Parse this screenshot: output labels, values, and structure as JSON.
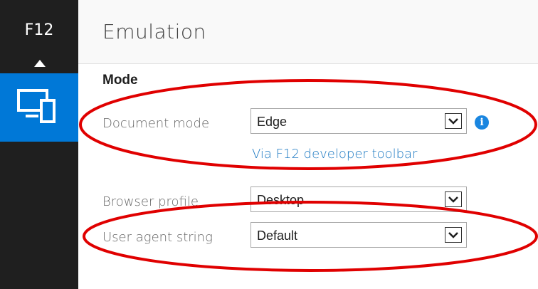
{
  "sidebar": {
    "title": "F12",
    "collapse_icon": "triangle-up-icon",
    "active_tab_icon": "emulation-devices-icon"
  },
  "header": {
    "title": "Emulation"
  },
  "mode": {
    "section_title": "Mode",
    "document_mode": {
      "label": "Document mode",
      "value": "Edge",
      "info_icon": "info-icon",
      "info_glyph": "i"
    },
    "via_link": "Via F12 developer toolbar",
    "browser_profile": {
      "label": "Browser profile",
      "value": "Desktop"
    },
    "user_agent": {
      "label": "User agent string",
      "value": "Default"
    }
  },
  "colors": {
    "sidebar_bg": "#1f1f1f",
    "active_tab_bg": "#0078d7",
    "link": "#1a78c2",
    "annotation_red": "#e00000"
  }
}
